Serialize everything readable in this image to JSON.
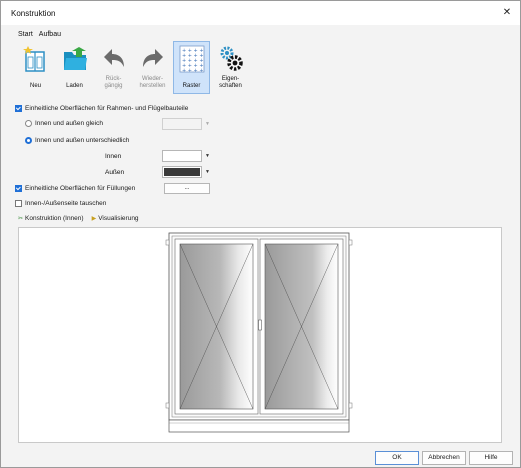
{
  "window": {
    "title": "Konstruktion",
    "close_glyph": "✕"
  },
  "menu": {
    "items": [
      "Start",
      "Aufbau"
    ]
  },
  "toolbar": {
    "buttons": [
      {
        "label": "Neu",
        "icon": "new-window-icon",
        "enabled": true
      },
      {
        "label": "Laden",
        "icon": "folder-open-icon",
        "enabled": true
      },
      {
        "label": "Rück-\ngängig",
        "icon": "undo-arrow-icon",
        "enabled": false
      },
      {
        "label": "Wieder-\nherstellen",
        "icon": "redo-arrow-icon",
        "enabled": false
      },
      {
        "label": "Raster",
        "icon": "grid-icon",
        "enabled": true,
        "active": true
      },
      {
        "label": "Eigen-\nschaften",
        "icon": "gears-icon",
        "enabled": true
      }
    ]
  },
  "surfaces": {
    "uniform_frame_label": "Einheitliche Oberflächen für Rahmen- und Flügelbauteile",
    "uniform_frame_checked": true,
    "same_inside_outside_label": "Innen und außen gleich",
    "different_inside_outside_label": "Innen und außen unterschiedlich",
    "selected_option": "different",
    "inside_label": "Innen",
    "outside_label": "Außen",
    "inside_color": "#ffffff",
    "outside_color": "#3a3a3a",
    "uniform_fill_label": "Einheitliche Oberflächen für Füllungen",
    "uniform_fill_checked": true,
    "fill_button_label": "...",
    "swap_label": "Innen-/Außenseite tauschen",
    "swap_checked": false
  },
  "view_tabs": [
    {
      "label": "Konstruktion (Innen)",
      "icon": "construction-icon"
    },
    {
      "label": "Visualisierung",
      "icon": "visualization-icon"
    }
  ],
  "footer": {
    "ok_label": "OK",
    "cancel_label": "Abbrechen",
    "help_label": "Hilfe"
  },
  "colors": {
    "accent": "#1f6fd6",
    "raster_active_bg": "#cfe3fa",
    "undo_redo_gray": "#6b6b6b",
    "folder_teal": "#1a8fbf",
    "door_frame": "#d8d8d8"
  }
}
